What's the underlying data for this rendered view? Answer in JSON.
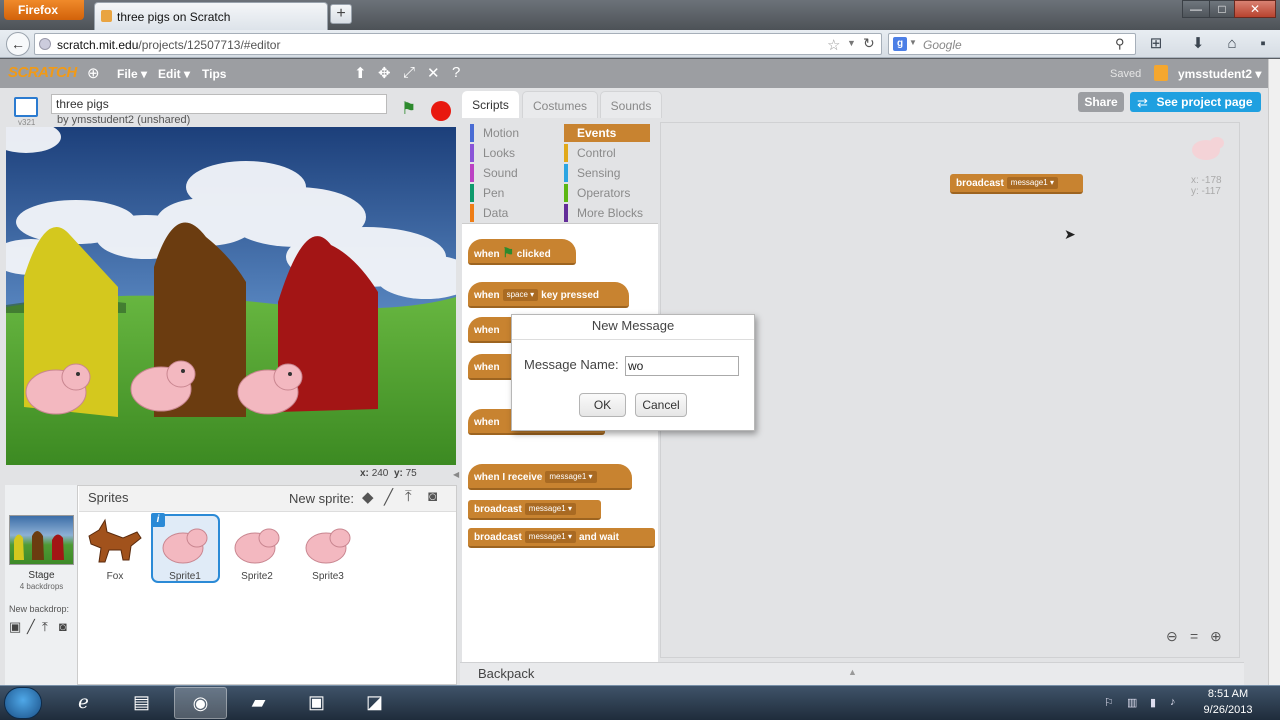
{
  "browser": {
    "app_button": "Firefox",
    "tab_title": "three pigs on Scratch",
    "new_tab": "+",
    "url_host": "scratch.mit.edu",
    "url_path": "/projects/12507713/#editor",
    "search_placeholder": "Google",
    "window_controls": [
      "—",
      "□",
      "✕"
    ]
  },
  "menubar": {
    "logo": "SCRATCH",
    "file": "File ▾",
    "edit": "Edit ▾",
    "tips": "Tips",
    "saved": "Saved",
    "username": "ymsstudent2 ▾"
  },
  "project": {
    "title": "three pigs",
    "byline": "by ymsstudent2 (unshared)",
    "version": "v321"
  },
  "stage": {
    "x_label": "x:",
    "x_value": "240",
    "y_label": "y:",
    "y_value": "75"
  },
  "sprites_pane": {
    "header": "Sprites",
    "new_sprite": "New sprite:",
    "stage_name": "Stage",
    "stage_backdrops": "4 backdrops",
    "new_backdrop": "New backdrop:",
    "sprites": [
      {
        "name": "Fox"
      },
      {
        "name": "Sprite1"
      },
      {
        "name": "Sprite2"
      },
      {
        "name": "Sprite3"
      }
    ]
  },
  "tabs": {
    "scripts": "Scripts",
    "costumes": "Costumes",
    "sounds": "Sounds"
  },
  "share": "Share",
  "project_page": "See project page",
  "categories": {
    "left": [
      {
        "label": "Motion",
        "color": "#4a6cd4"
      },
      {
        "label": "Looks",
        "color": "#8a55d7"
      },
      {
        "label": "Sound",
        "color": "#bb42c3"
      },
      {
        "label": "Pen",
        "color": "#0e9a6c"
      },
      {
        "label": "Data",
        "color": "#ee7d16"
      }
    ],
    "right": [
      {
        "label": "Events",
        "color": "#c88330"
      },
      {
        "label": "Control",
        "color": "#e1a91a"
      },
      {
        "label": "Sensing",
        "color": "#2ca5e2"
      },
      {
        "label": "Operators",
        "color": "#5cb712"
      },
      {
        "label": "More Blocks",
        "color": "#632d99"
      }
    ]
  },
  "blocks": {
    "when": "when",
    "clicked": "clicked",
    "space": "space",
    "key_pressed": "key pressed",
    "when_receive": "when I receive",
    "broadcast": "broadcast",
    "and_wait": "and wait",
    "message1": "message1"
  },
  "script_area": {
    "broadcast_block": "broadcast",
    "broadcast_msg": "message1",
    "x_readout": "x: -178",
    "y_readout": "y: -117"
  },
  "backpack": "Backpack",
  "dialog": {
    "title": "New Message",
    "label": "Message Name:",
    "value": "wo",
    "ok": "OK",
    "cancel": "Cancel"
  },
  "taskbar": {
    "time": "8:51 AM",
    "date": "9/26/2013"
  }
}
